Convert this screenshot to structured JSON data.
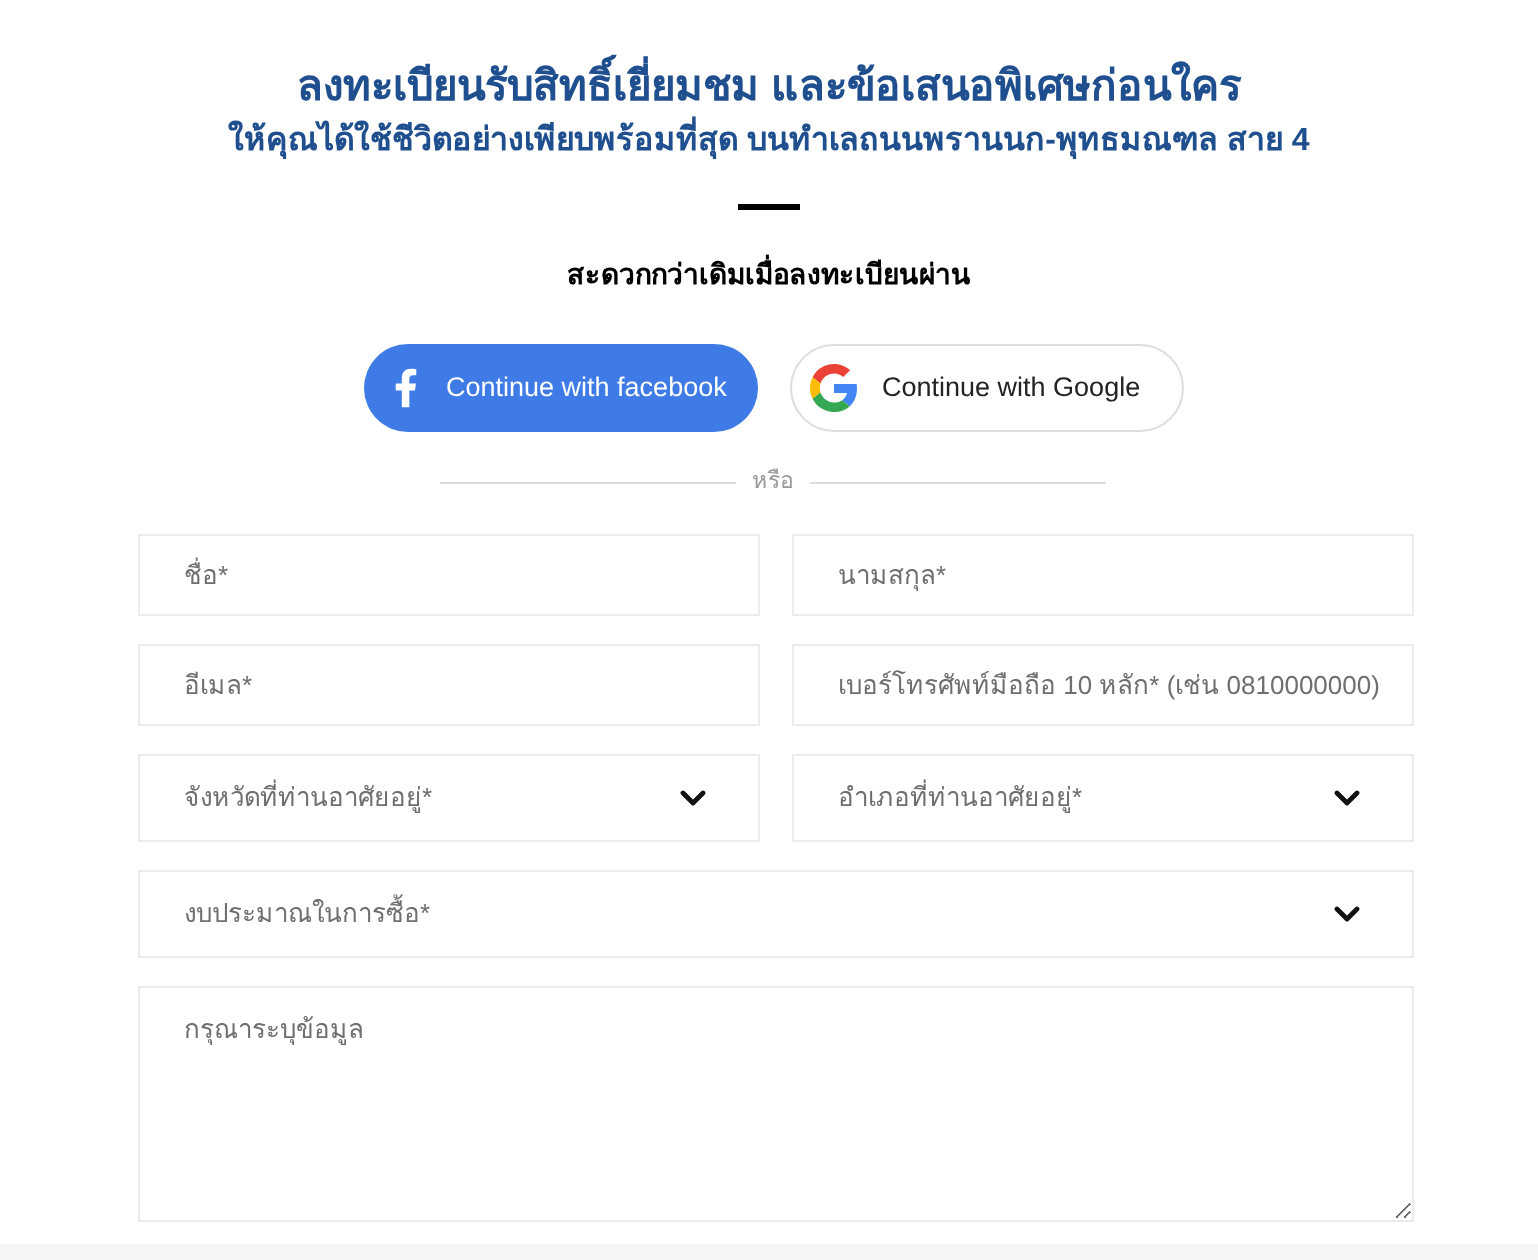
{
  "heading": {
    "title": "ลงทะเบียนรับสิทธิ์เยี่ยมชม และข้อเสนอพิเศษก่อนใคร",
    "subtitle": "ให้คุณได้ใช้ชีวิตอย่างเพียบพร้อมที่สุด บนทำเลถนนพรานนก-พุทธมณฑล สาย 4"
  },
  "social_prompt": "สะดวกกว่าเดิมเมื่อลงทะเบียนผ่าน",
  "social_buttons": [
    {
      "kind": "facebook",
      "label": "Continue with facebook"
    },
    {
      "kind": "google",
      "label": "Continue with Google"
    }
  ],
  "divider_label": "หรือ",
  "form_rows": [
    [
      {
        "kind": "text",
        "placeholder": "ชื่อ*"
      },
      {
        "kind": "text",
        "placeholder": "นามสกุล*"
      }
    ],
    [
      {
        "kind": "text",
        "placeholder": "อีเมล*"
      },
      {
        "kind": "text",
        "placeholder": "เบอร์โทรศัพท์มือถือ 10 หลัก* (เช่น 0810000000)"
      }
    ],
    [
      {
        "kind": "select",
        "placeholder": "จังหวัดที่ท่านอาศัยอยู่*"
      },
      {
        "kind": "select",
        "placeholder": "อำเภอที่ท่านอาศัยอยู่*"
      }
    ],
    [
      {
        "kind": "select",
        "placeholder": "งบประมาณในการซื้อ*"
      }
    ],
    [
      {
        "kind": "textarea",
        "placeholder": "กรุณาระบุข้อมูล"
      }
    ]
  ]
}
